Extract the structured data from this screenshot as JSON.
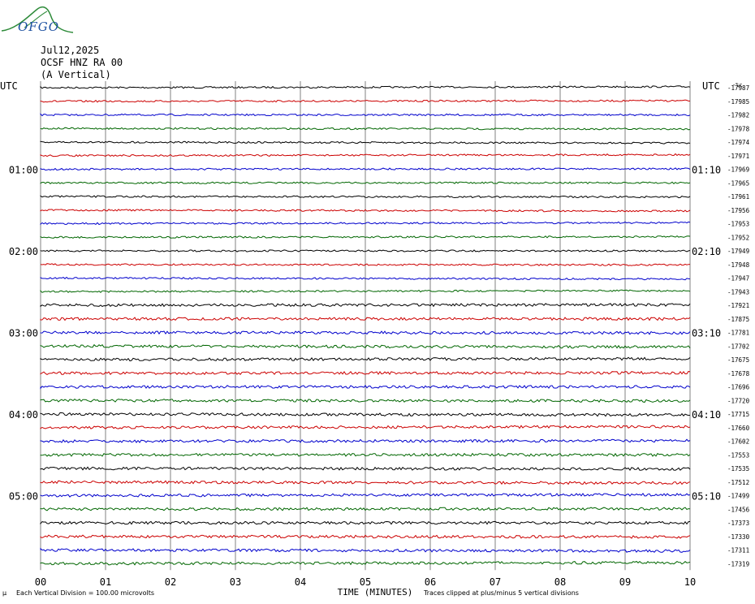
{
  "header": {
    "logo_text": "OFGO",
    "date": "Jul12,2025",
    "station": "OCSF HNZ RA 00",
    "component": "(A Vertical)"
  },
  "colors": {
    "trace_cycle": [
      "#000000",
      "#cc0000",
      "#0000cc",
      "#006600"
    ],
    "grid": "#808080"
  },
  "chart_data": {
    "type": "line",
    "description_kind": "helicorder",
    "left_axis_label": "UTC",
    "right_axis_label": "UTC",
    "left_hour_labels": [
      {
        "row": 6,
        "label": "01:00"
      },
      {
        "row": 12,
        "label": "02:00"
      },
      {
        "row": 18,
        "label": "03:00"
      },
      {
        "row": 24,
        "label": "04:00"
      },
      {
        "row": 30,
        "label": "05:00"
      }
    ],
    "right_hour_labels": [
      {
        "row": 6,
        "label": "01:10"
      },
      {
        "row": 12,
        "label": "02:10"
      },
      {
        "row": 18,
        "label": "03:10"
      },
      {
        "row": 24,
        "label": "04:10"
      },
      {
        "row": 30,
        "label": "05:10"
      }
    ],
    "x_ticks": [
      "00",
      "01",
      "02",
      "03",
      "04",
      "05",
      "06",
      "07",
      "08",
      "09",
      "10"
    ],
    "xlabel": "TIME (MINUTES)",
    "row_values": [
      -17987,
      -17985,
      -17982,
      -17978,
      -17974,
      -17971,
      -17969,
      -17965,
      -17961,
      -17956,
      -17953,
      -17952,
      -17949,
      -17948,
      -17947,
      -17943,
      -17921,
      -17875,
      -17781,
      -17702,
      -17675,
      -17678,
      -17696,
      -17720,
      -17715,
      -17660,
      -17602,
      -17553,
      -17535,
      -17512,
      -17499,
      -17456,
      -17373,
      -17330,
      -17311,
      -17319
    ],
    "row_value_unit_prefix": "-%c",
    "scale_note": "Each Vertical Division =  100.00 microvolts",
    "clip_note": "Traces clipped at plus/minus 5 vertical divisions",
    "corner_mark": "μ"
  }
}
